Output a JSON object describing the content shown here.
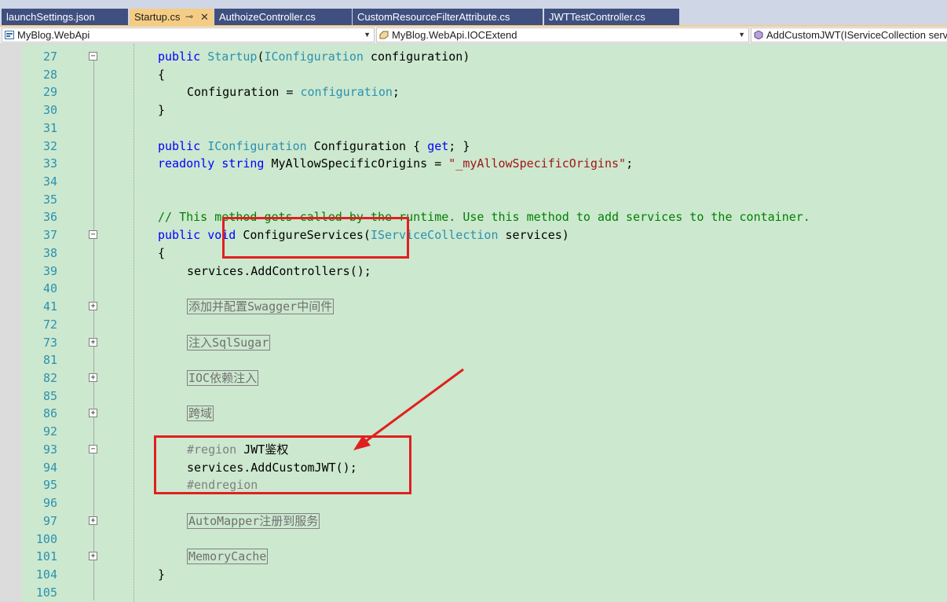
{
  "tabs": [
    {
      "label": "launchSettings.json",
      "active": false
    },
    {
      "label": "Startup.cs",
      "active": true,
      "pin": "⊸",
      "close": "✕"
    },
    {
      "label": "AuthoizeController.cs",
      "active": false
    },
    {
      "label": "CustomResourceFilterAttribute.cs",
      "active": false
    },
    {
      "label": "JWTTestController.cs",
      "active": false
    }
  ],
  "navbar": {
    "project": "MyBlog.WebApi",
    "class": "MyBlog.WebApi.IOCExtend",
    "member": "AddCustomJWT(IServiceCollection servi"
  },
  "gutter": {
    "line_numbers": [
      "27",
      "28",
      "29",
      "30",
      "31",
      "32",
      "33",
      "34",
      "35",
      "36",
      "37",
      "38",
      "39",
      "40",
      "41",
      "72",
      "73",
      "81",
      "82",
      "85",
      "86",
      "92",
      "93",
      "94",
      "95",
      "96",
      "97",
      "100",
      "101",
      "104",
      "105"
    ]
  },
  "code": {
    "l27": {
      "kw": "public",
      "type": "Startup",
      "p1": "(",
      "type2": "IConfiguration",
      "rest": " configuration)"
    },
    "l28": "{",
    "l29": {
      "a": "Configuration",
      "b": " = ",
      "c": "configuration",
      "d": ";"
    },
    "l30": "}",
    "l32": {
      "kw": "public",
      "type": "IConfiguration",
      "mid": " Configuration { ",
      "kw2": "get",
      "end": "; }"
    },
    "l33": {
      "kw": "readonly",
      "kw2": "string",
      "mid": " MyAllowSpecificOrigins = ",
      "str": "\"_myAllowSpecificOrigins\"",
      "end": ";"
    },
    "l36": "// This method gets called by the runtime. Use this method to add services to the container.",
    "l37": {
      "kw": "public",
      "kw2": "void",
      "name": " ConfigureServices(",
      "type": "IServiceCollection",
      "rest": " services)"
    },
    "l38": "{",
    "l39": {
      "a": "services",
      "b": ".",
      "c": "AddControllers",
      "d": "();"
    },
    "l41": "添加并配置Swagger中间件",
    "l73": "注入SqlSugar",
    "l82": "IOC依赖注入",
    "l86": "跨域",
    "l93": {
      "pre": "#region",
      "label": " JWT鉴权"
    },
    "l94": {
      "a": "services",
      "b": ".",
      "c": "AddCustomJWT",
      "d": "();"
    },
    "l95": "#endregion",
    "l97": "AutoMapper注册到服务",
    "l101": "MemoryCache",
    "l104": "}"
  },
  "fold_glyphs": {
    "expanded": "−",
    "collapsed": "+"
  },
  "colors": {
    "keyword": "#0000ff",
    "type": "#2b91af",
    "string": "#a31515",
    "comment": "#008000",
    "annotation": "#e02020",
    "background": "#cce8cf"
  }
}
